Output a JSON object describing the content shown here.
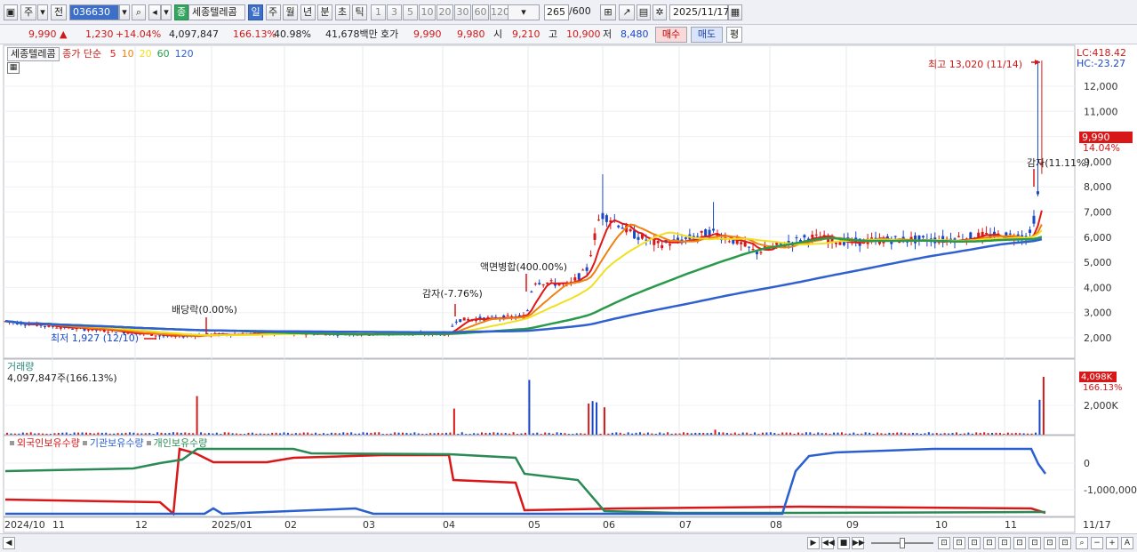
{
  "toolbar": {
    "period_type": "주",
    "prev_label": "전",
    "stock_code": "036630",
    "stock_name": "세종텔레콤",
    "badge": "종",
    "periods": [
      "일",
      "주",
      "월",
      "년",
      "분",
      "초",
      "틱"
    ],
    "active_period": "일",
    "intervals": [
      "1",
      "3",
      "5",
      "10",
      "20",
      "30",
      "60",
      "120"
    ],
    "count": "265",
    "count_total": "/600",
    "date": "2025/11/17"
  },
  "quote": {
    "price": "9,990",
    "arrow": "▲",
    "change": "1,230",
    "change_pct": "+14.04%",
    "volume": "4,097,847",
    "volume_ratio": "166.13%",
    "turnover_pct": "40.98%",
    "amount": "41,678백만",
    "hoga_label": "호가",
    "ask": "9,990",
    "bid": "9,980",
    "open_label": "시",
    "open": "9,210",
    "high_label": "고",
    "high": "10,900",
    "low_label": "저",
    "low": "8,480",
    "buy_label": "매수",
    "sell_label": "매도",
    "avg_label": "평"
  },
  "price_panel": {
    "name": "세종텔레콤",
    "ma_label": "종가 단순",
    "ma_periods": [
      "5",
      "10",
      "20",
      "60",
      "120"
    ],
    "ma_colors": [
      "#e01818",
      "#f08010",
      "#f0e020",
      "#2a9a4a",
      "#3060d0"
    ],
    "lc": "LC:418.42",
    "hc": "HC:-23.27",
    "current_price": "9,990",
    "current_pct": "14.04%",
    "y_ticks": [
      "12,000",
      "11,000",
      "10,000",
      "9,000",
      "8,000",
      "7,000",
      "6,000",
      "5,000",
      "4,000",
      "3,000",
      "2,000"
    ],
    "annotations": {
      "high": "최고 13,020 (11/14)",
      "low": "최저 1,927 (12/10)",
      "dividend": "배당락(0.00%)",
      "cap_reduction1": "감자(-7.76%)",
      "split": "액면병합(400.00%)",
      "cap_reduction2": "감자(11.11%)"
    }
  },
  "volume_panel": {
    "title": "거래량",
    "value": "4,097,847주(166.13%)",
    "right_value": "4,098K",
    "right_pct": "166.13%",
    "y_tick": "2,000K"
  },
  "holding_panel": {
    "series": [
      "외국인보유수량",
      "기관보유수량",
      "개인보유수량"
    ],
    "colors": [
      "#d81818",
      "#2a5fd0",
      "#2a8a55"
    ],
    "y_ticks": [
      "0",
      "-1,000,000"
    ]
  },
  "x_axis": {
    "labels": [
      "2024/10",
      "11",
      "12",
      "2025/01",
      "02",
      "03",
      "04",
      "05",
      "06",
      "07",
      "08",
      "09",
      "10",
      "11"
    ],
    "right_label": "11/17"
  },
  "chart_data": {
    "type": "line",
    "title": "",
    "series_price_approx": [
      {
        "month": "2024/10",
        "close": 2600
      },
      {
        "month": "2024/11",
        "close": 2250
      },
      {
        "month": "2024/12",
        "close": 2050
      },
      {
        "month": "2025/01",
        "close": 2150
      },
      {
        "month": "2025/02",
        "close": 2150
      },
      {
        "month": "2025/03",
        "close": 2150
      },
      {
        "month": "2025/04",
        "close": 2800
      },
      {
        "month": "2025/05",
        "close": 4200
      },
      {
        "month": "2025/06",
        "close": 6300
      },
      {
        "month": "2025/07",
        "close": 5900
      },
      {
        "month": "2025/08",
        "close": 5800
      },
      {
        "month": "2025/09",
        "close": 5800
      },
      {
        "month": "2025/10",
        "close": 5900
      },
      {
        "month": "2025/11",
        "close": 9990
      }
    ],
    "ylim": [
      1500,
      13500
    ]
  }
}
